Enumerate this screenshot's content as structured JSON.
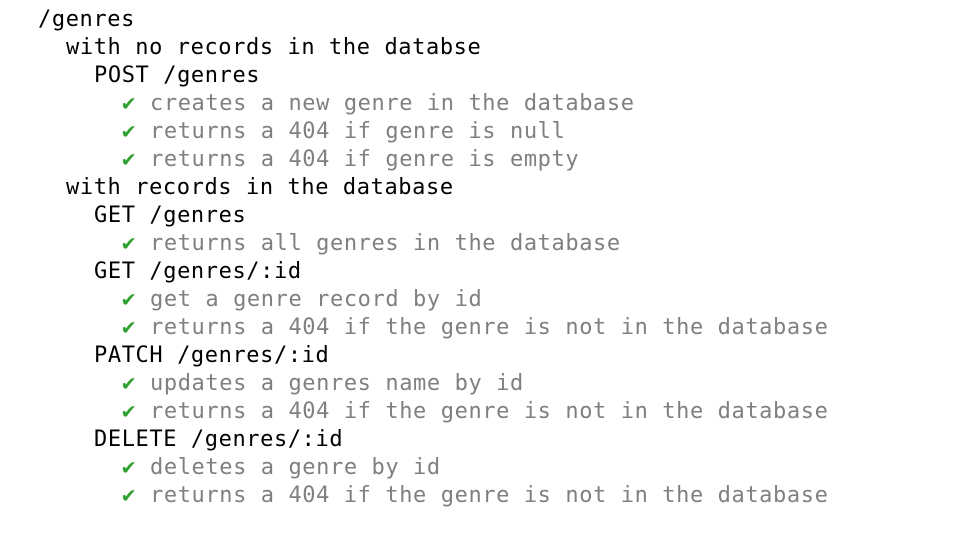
{
  "colors": {
    "background": "#ffffff",
    "heading": "#000000",
    "test_text": "#808080",
    "pass_check": "#2e9e2e"
  },
  "check_glyph": "✔",
  "check_icon": "check-mark-icon",
  "lines": [
    {
      "kind": "suite",
      "level": 0,
      "text": "/genres"
    },
    {
      "kind": "suite",
      "level": 1,
      "text": "with no records in the databse"
    },
    {
      "kind": "suite",
      "level": 2,
      "text": "POST /genres"
    },
    {
      "kind": "test",
      "level": 3,
      "status": "passed",
      "text": "creates a new genre in the database"
    },
    {
      "kind": "test",
      "level": 3,
      "status": "passed",
      "text": "returns a 404 if genre is null"
    },
    {
      "kind": "test",
      "level": 3,
      "status": "passed",
      "text": "returns a 404 if genre is empty"
    },
    {
      "kind": "suite",
      "level": 1,
      "text": "with records in the database"
    },
    {
      "kind": "suite",
      "level": 2,
      "text": "GET /genres"
    },
    {
      "kind": "test",
      "level": 3,
      "status": "passed",
      "text": "returns all genres in the database"
    },
    {
      "kind": "suite",
      "level": 2,
      "text": "GET /genres/:id"
    },
    {
      "kind": "test",
      "level": 3,
      "status": "passed",
      "text": "get a genre record by id"
    },
    {
      "kind": "test",
      "level": 3,
      "status": "passed",
      "text": "returns a 404 if the genre is not in the database"
    },
    {
      "kind": "suite",
      "level": 2,
      "text": "PATCH /genres/:id"
    },
    {
      "kind": "test",
      "level": 3,
      "status": "passed",
      "text": "updates a genres name by id"
    },
    {
      "kind": "test",
      "level": 3,
      "status": "passed",
      "text": "returns a 404 if the genre is not in the database"
    },
    {
      "kind": "suite",
      "level": 2,
      "text": "DELETE /genres/:id"
    },
    {
      "kind": "test",
      "level": 3,
      "status": "passed",
      "text": "deletes a genre by id"
    },
    {
      "kind": "test",
      "level": 3,
      "status": "passed",
      "text": "returns a 404 if the genre is not in the database"
    }
  ]
}
